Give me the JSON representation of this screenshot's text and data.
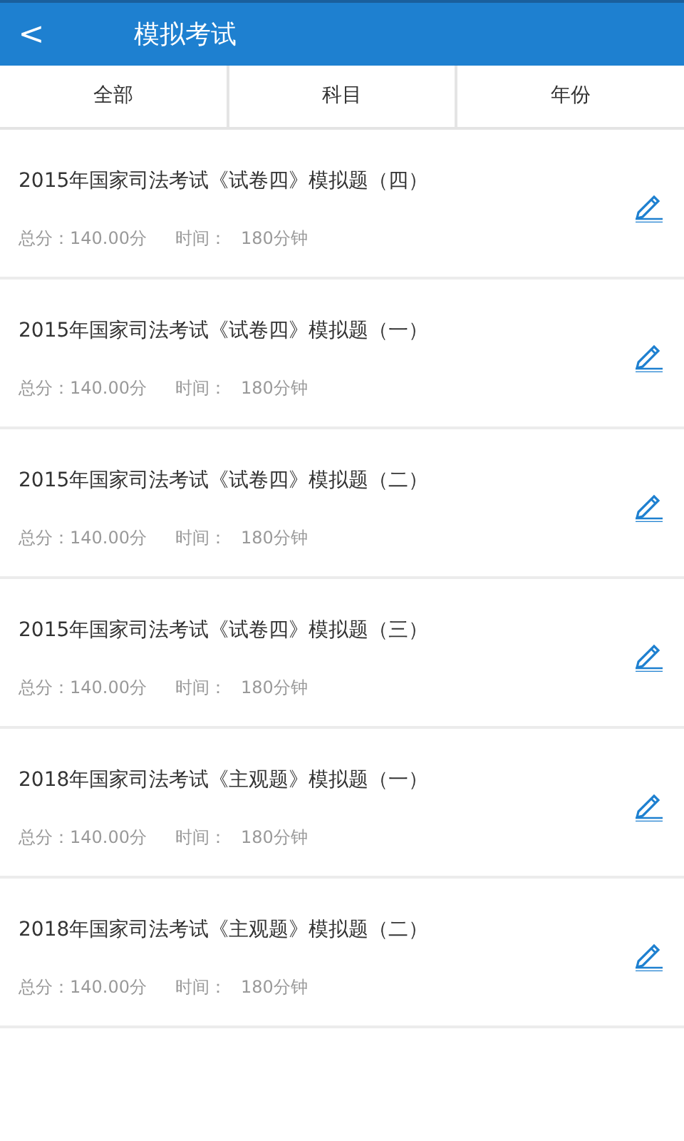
{
  "header": {
    "back": "<",
    "title": "模拟考试"
  },
  "filters": [
    "全部",
    "科目",
    "年份"
  ],
  "exams": [
    {
      "title": "2015年国家司法考试《试卷四》模拟题（四）",
      "score_label": "总分：",
      "score": "140.00分",
      "time_label": "时间：",
      "time": "180分钟"
    },
    {
      "title": "2015年国家司法考试《试卷四》模拟题（一）",
      "score_label": "总分：",
      "score": "140.00分",
      "time_label": "时间：",
      "time": "180分钟"
    },
    {
      "title": "2015年国家司法考试《试卷四》模拟题（二）",
      "score_label": "总分：",
      "score": "140.00分",
      "time_label": "时间：",
      "time": "180分钟"
    },
    {
      "title": "2015年国家司法考试《试卷四》模拟题（三）",
      "score_label": "总分：",
      "score": "140.00分",
      "time_label": "时间：",
      "time": "180分钟"
    },
    {
      "title": "2018年国家司法考试《主观题》模拟题（一）",
      "score_label": "总分：",
      "score": "140.00分",
      "time_label": "时间：",
      "time": "180分钟"
    },
    {
      "title": "2018年国家司法考试《主观题》模拟题（二）",
      "score_label": "总分：",
      "score": "140.00分",
      "time_label": "时间：",
      "time": "180分钟"
    }
  ]
}
